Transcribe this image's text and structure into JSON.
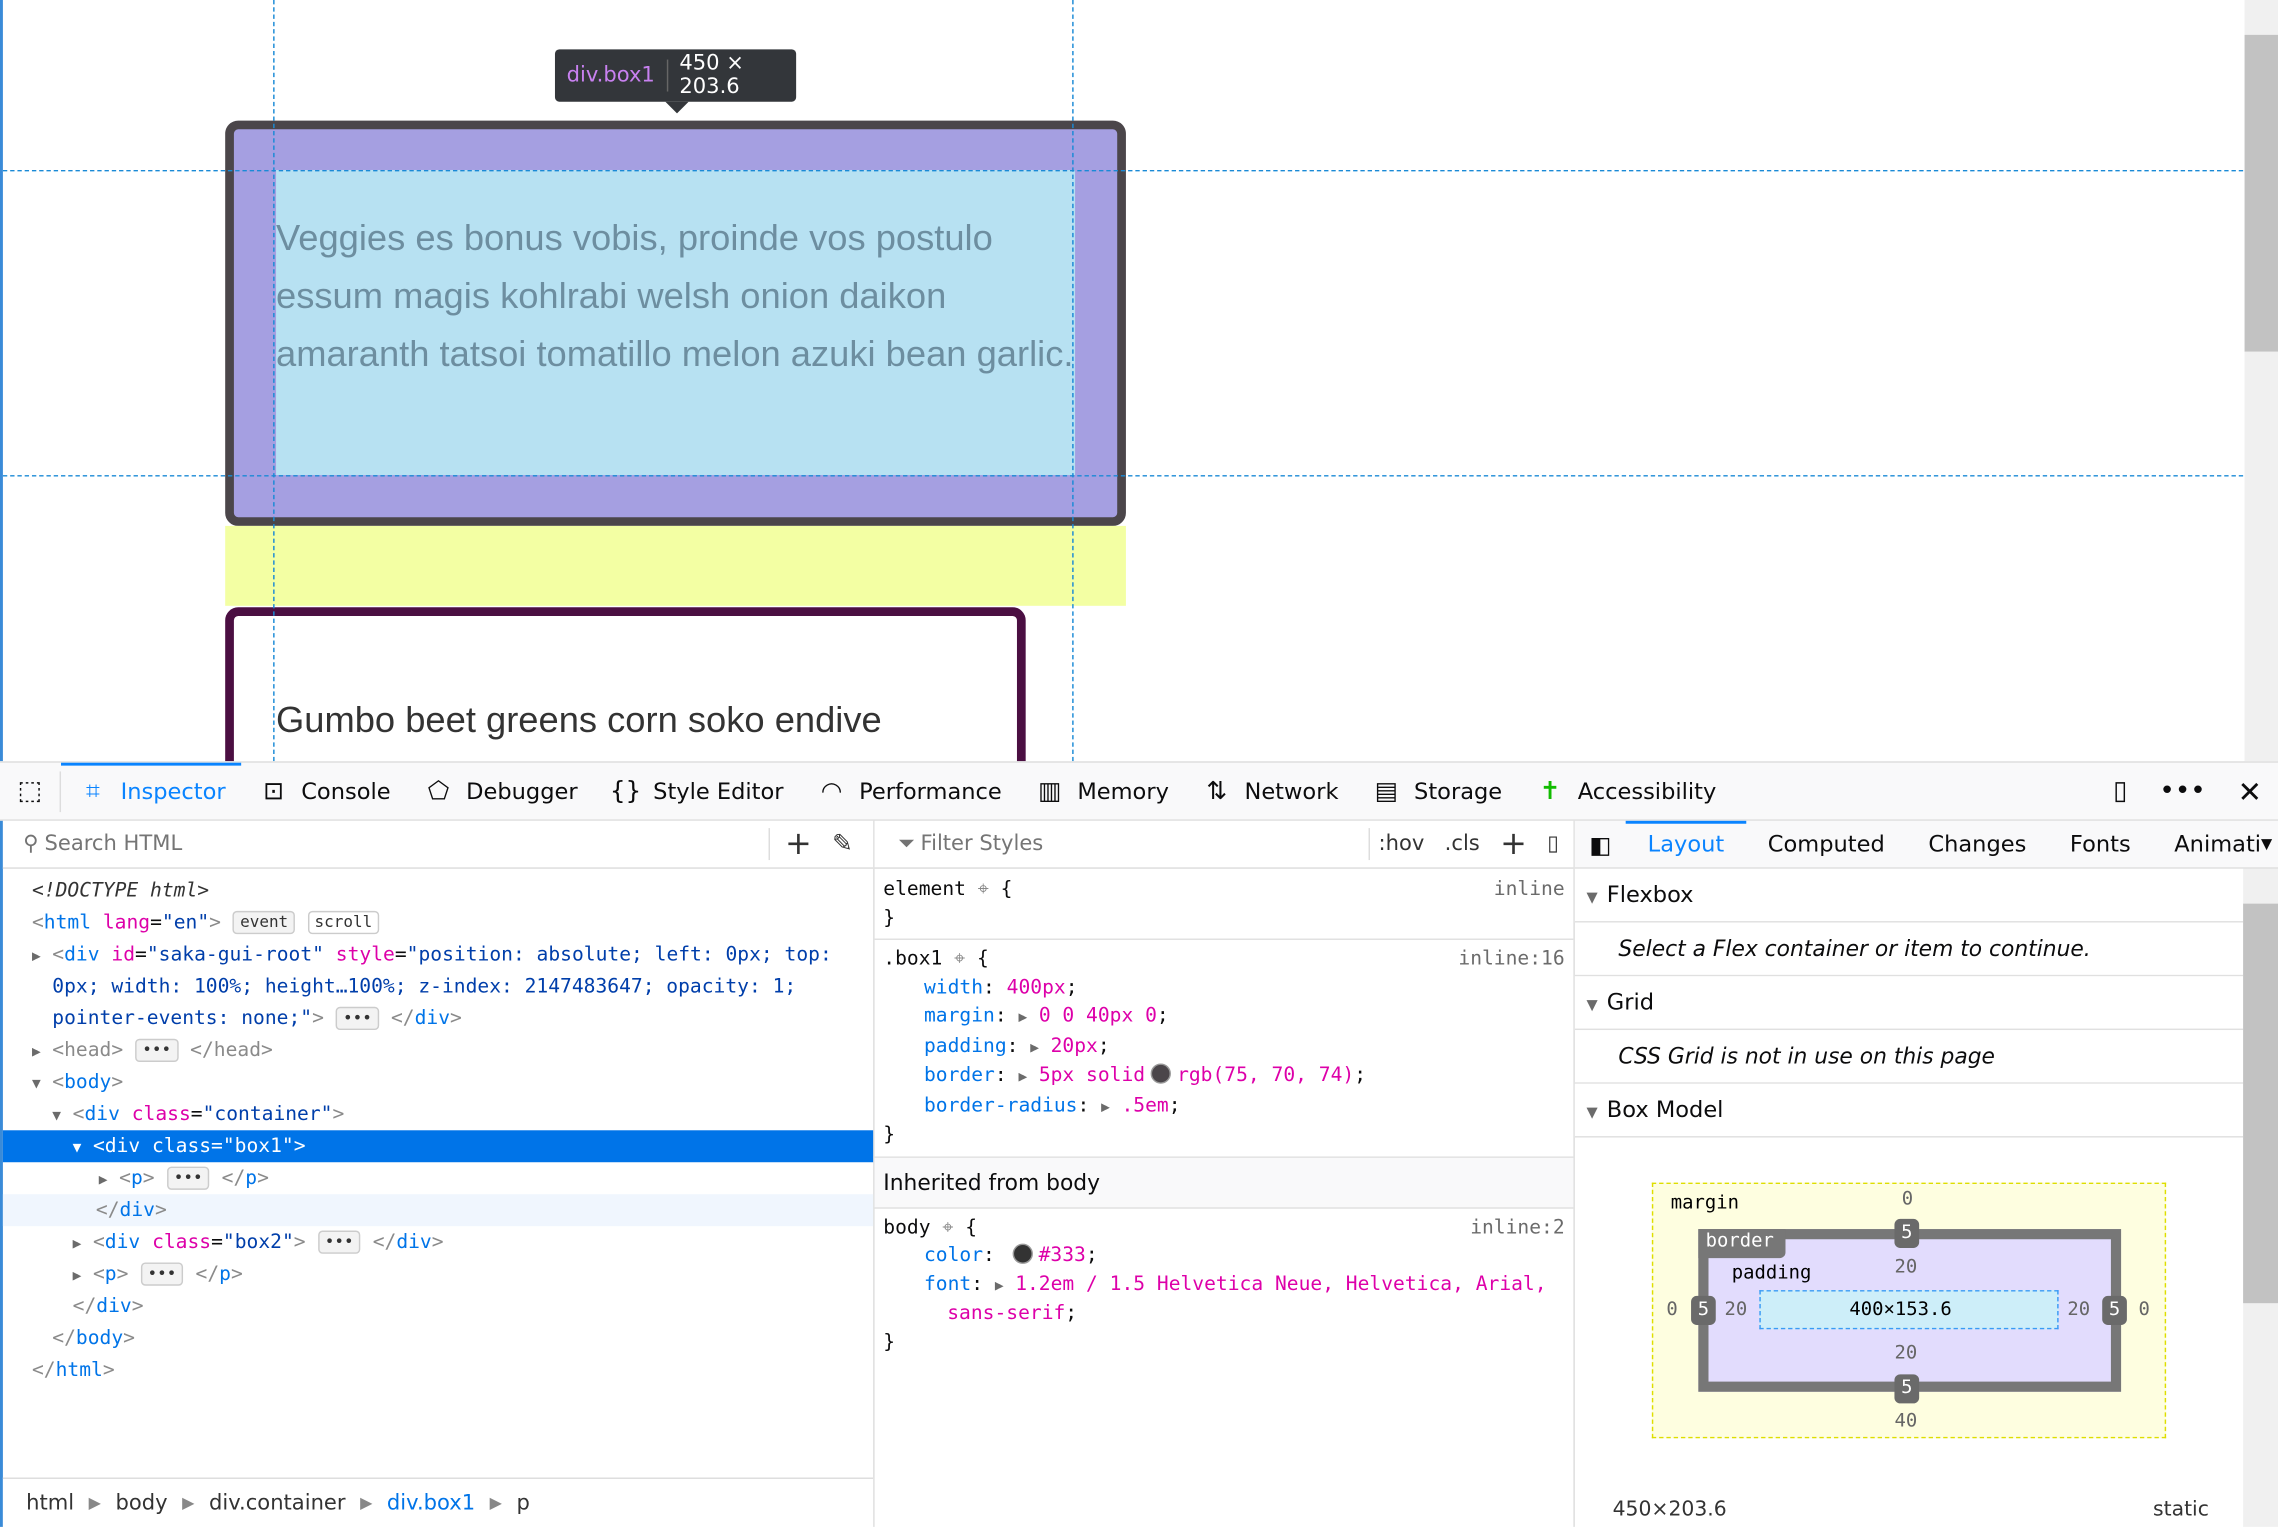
{
  "page": {
    "tooltip": {
      "selector": "div.box1",
      "size": "450 × 203.6"
    },
    "box1_text": "Veggies es bonus vobis, proinde vos postulo essum magis kohlrabi welsh onion daikon amaranth tatsoi tomatillo melon azuki bean garlic.",
    "box2_text": "Gumbo beet greens corn soko endive"
  },
  "toolbar": {
    "tabs": [
      {
        "label": "Inspector",
        "icon": "inspector-icon"
      },
      {
        "label": "Console",
        "icon": "console-icon"
      },
      {
        "label": "Debugger",
        "icon": "debugger-icon"
      },
      {
        "label": "Style Editor",
        "icon": "braces-icon"
      },
      {
        "label": "Performance",
        "icon": "gauge-icon"
      },
      {
        "label": "Memory",
        "icon": "memory-chip-icon"
      },
      {
        "label": "Network",
        "icon": "arrows-updown-icon"
      },
      {
        "label": "Storage",
        "icon": "storage-icon"
      },
      {
        "label": "Accessibility",
        "icon": "accessibility-icon"
      }
    ],
    "active": "Inspector"
  },
  "inspector": {
    "search_placeholder": "Search HTML",
    "badges": {
      "event": "event",
      "scroll": "scroll"
    },
    "tree": {
      "doctype": "<!DOCTYPE html>",
      "saka_style1": "\"position: absolute; left: 0px; top:",
      "saka_style2": "0px; width: 100%; height…100%; z-index: 2147483647; opacity: 1;",
      "saka_style3": "pointer-events: none;\""
    },
    "breadcrumbs": [
      "html",
      "body",
      "div.container",
      "div.box1",
      "p"
    ]
  },
  "rules": {
    "filter_placeholder": "Filter Styles",
    "hov": ":hov",
    "cls": ".cls",
    "element": {
      "selector": "element",
      "source": "inline"
    },
    "box1": {
      "selector": ".box1",
      "source": "inline:16",
      "decls": [
        {
          "p": "width",
          "v": "400px"
        },
        {
          "p": "margin",
          "v": "0 0 40px 0"
        },
        {
          "p": "padding",
          "v": "20px"
        },
        {
          "p": "border",
          "v": "5px solid",
          "color": "rgb(75, 70, 74)"
        },
        {
          "p": "border-radius",
          "v": ".5em"
        }
      ]
    },
    "inherited": "Inherited from body",
    "body": {
      "selector": "body",
      "source": "inline:2",
      "color": "#333",
      "font1": "1.2em / 1.5 Helvetica Neue, Helvetica, Arial,",
      "font2": "sans-serif"
    }
  },
  "layout": {
    "tabs": [
      "Layout",
      "Computed",
      "Changes",
      "Fonts",
      "Animati"
    ],
    "flexbox": "Flexbox",
    "flex_msg": "Select a Flex container or item to continue.",
    "grid": "Grid",
    "grid_msg": "CSS Grid is not in use on this page",
    "boxmodel": "Box Model",
    "bm": {
      "margin_label": "margin",
      "border_label": "border",
      "padding_label": "padding",
      "margin": {
        "top": "0",
        "right": "0",
        "bottom": "40",
        "left": "0"
      },
      "border": {
        "top": "5",
        "right": "5",
        "bottom": "5",
        "left": "5"
      },
      "padding": {
        "top": "20",
        "right": "20",
        "bottom": "20",
        "left": "20"
      },
      "content": "400×153.6"
    },
    "size": "450×203.6",
    "position": "static"
  }
}
